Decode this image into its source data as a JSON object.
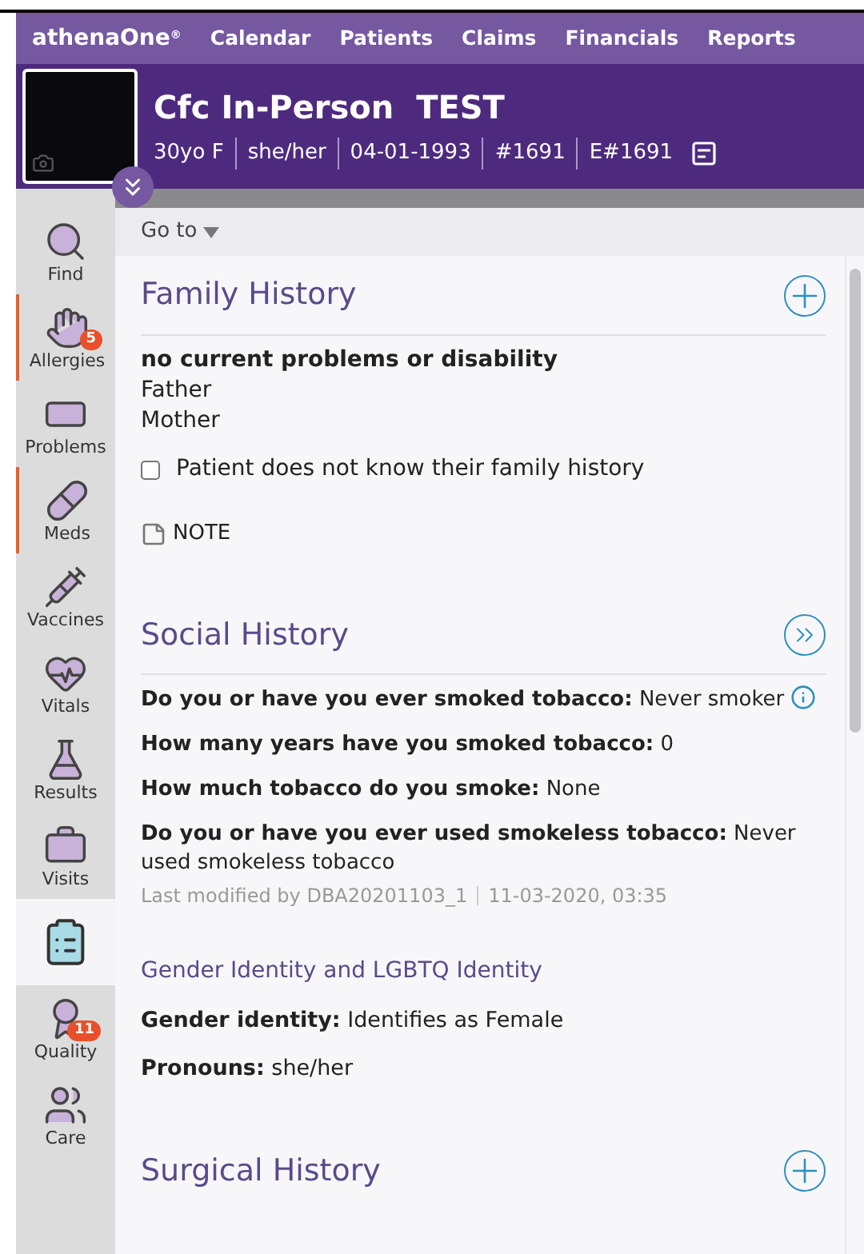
{
  "nav": {
    "logo": "athenaOne",
    "logo_mark": "®",
    "items": [
      "Calendar",
      "Patients",
      "Claims",
      "Financials",
      "Reports"
    ]
  },
  "patient": {
    "name": "Cfc In-Person  TEST",
    "details": [
      "30yo F",
      "she/her",
      "04-01-1993",
      "#1691",
      "E#1691"
    ]
  },
  "sidebar": {
    "items": [
      {
        "label": "Find",
        "flagged": false,
        "selected": false
      },
      {
        "label": "Allergies",
        "badge": "5",
        "flagged": true,
        "selected": false
      },
      {
        "label": "Problems",
        "flagged": false,
        "selected": false
      },
      {
        "label": "Meds",
        "flagged": true,
        "selected": false
      },
      {
        "label": "Vaccines",
        "flagged": false,
        "selected": false
      },
      {
        "label": "Vitals",
        "flagged": false,
        "selected": false
      },
      {
        "label": "Results",
        "flagged": false,
        "selected": false
      },
      {
        "label": "Visits",
        "flagged": false,
        "selected": false
      },
      {
        "flagged": false,
        "selected": true
      },
      {
        "label": "Quality",
        "badge": "11",
        "flagged": false,
        "selected": false
      },
      {
        "label": "Care",
        "flagged": false,
        "selected": false
      }
    ]
  },
  "goto": "Go to",
  "family_history": {
    "title": "Family History",
    "condition": "no current problems or disability",
    "relatives": [
      "Father",
      "Mother"
    ],
    "unknown_checkbox": {
      "label": "Patient does not know their family history",
      "checked": false
    },
    "note": "NOTE"
  },
  "social_history": {
    "title": "Social History",
    "rows": [
      {
        "text": "**Do you or have you ever smoked tobacco:** Never smoker",
        "info": true
      },
      {
        "text": "**How many years have you smoked tobacco:** 0",
        "info": false
      },
      {
        "text": "**How much tobacco do you smoke:** None",
        "info": false
      },
      {
        "text": "**Do you or have you ever used smokeless tobacco:** Never used smokeless tobacco",
        "info": false
      }
    ],
    "modified_by": "Last modified by DBA20201103_1",
    "modified_at": "11-03-2020, 03:35",
    "gender": {
      "title": "Gender Identity and LGBTQ Identity",
      "rows": [
        "**Gender identity:** Identifies as Female",
        "**Pronouns:** she/her"
      ]
    }
  },
  "surgical_history": {
    "title": "Surgical History"
  }
}
